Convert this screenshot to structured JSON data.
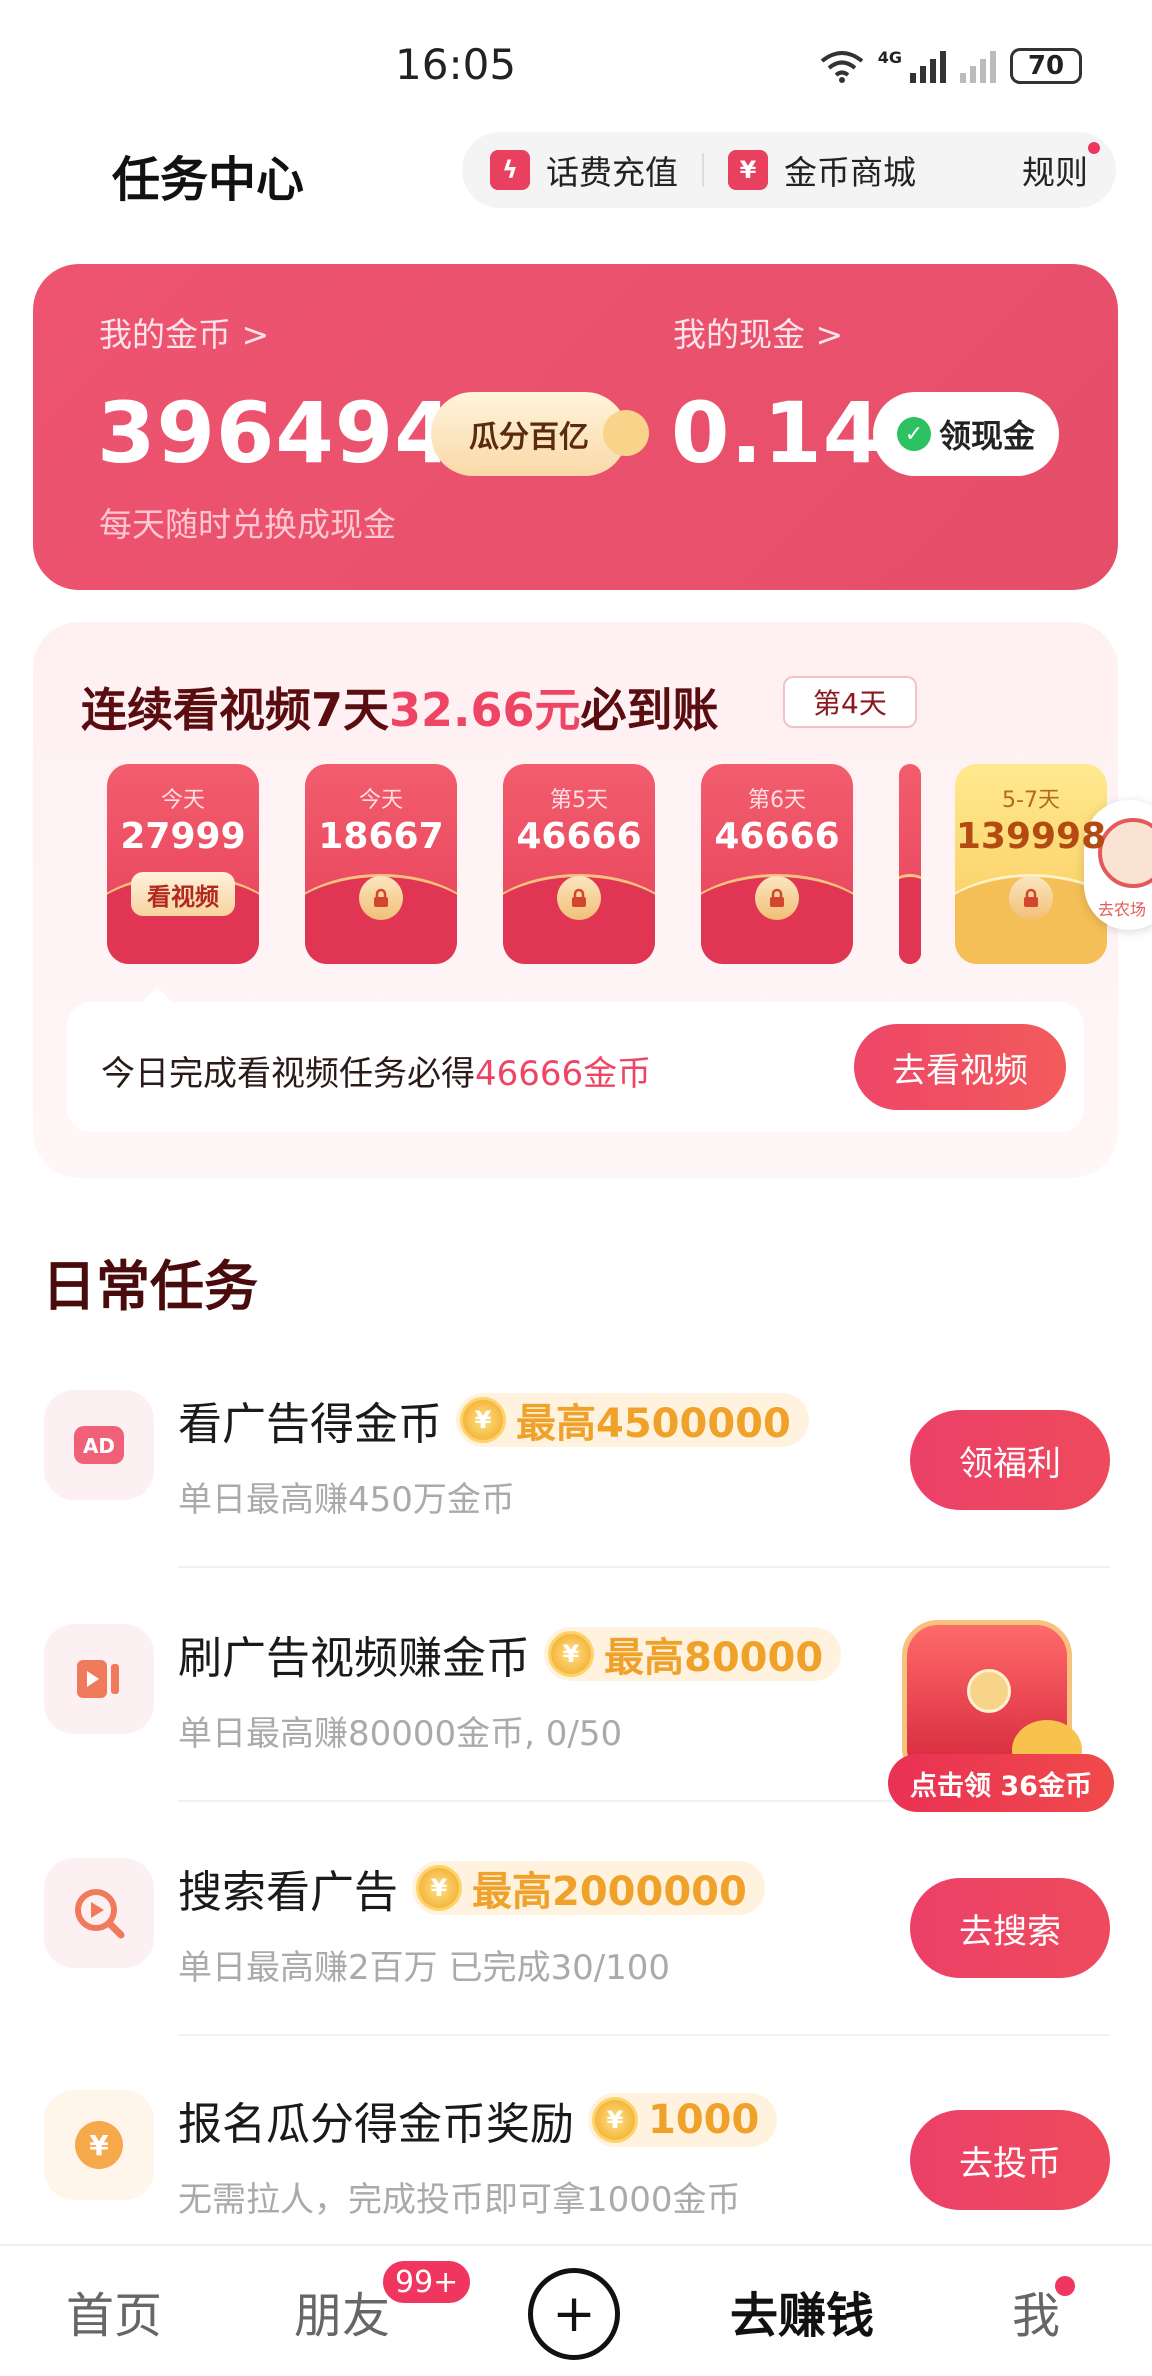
{
  "status": {
    "time": "16:05",
    "network": "4G",
    "battery": "70"
  },
  "header": {
    "title": "任务中心",
    "phone_recharge": "话费充值",
    "coin_mall": "金币商城",
    "rules": "规则"
  },
  "wallet": {
    "coins_label": "我的金币 >",
    "coins_value": "396494",
    "coins_sub": "每天随时兑换成现金",
    "split_button": "瓜分百亿",
    "cash_label": "我的现金 >",
    "cash_value": "0.14",
    "cash_button": "领现金"
  },
  "streak": {
    "title_prefix": "连续看视频7天",
    "title_amount": "32.66元",
    "title_suffix": "必到账",
    "day_tag": "第4天",
    "packets": [
      {
        "day": "今天",
        "value": "27999",
        "action": "看视频"
      },
      {
        "day": "今天",
        "value": "18667"
      },
      {
        "day": "第5天",
        "value": "46666"
      },
      {
        "day": "第6天",
        "value": "46666"
      },
      {
        "day": "5-7天",
        "value": "139998"
      }
    ],
    "notice_prefix": "今日完成看视频任务必得",
    "notice_amount": "46666金币",
    "notice_button": "去看视频"
  },
  "side_float": {
    "label": "去农场"
  },
  "daily": {
    "title": "日常任务",
    "tasks": [
      {
        "name": "看广告得金币",
        "badge": "最高4500000",
        "desc": "单日最高赚450万金币",
        "button": "领福利",
        "icon": "ad-icon"
      },
      {
        "name": "刷广告视频赚金币",
        "badge": "最高80000",
        "desc": "单日最高赚80000金币, 0/50",
        "button": "",
        "icon": "video-icon"
      },
      {
        "name": "搜索看广告",
        "badge": "最高2000000",
        "desc": "单日最高赚2百万 已完成30/100",
        "button": "去搜索",
        "icon": "search-play-icon"
      },
      {
        "name": "报名瓜分得金币奖励",
        "badge": "1000",
        "desc": "无需拉人，完成投币即可拿1000金币",
        "button": "去投币",
        "icon": "yuan-coin-icon"
      }
    ],
    "chest_label": "点击领 36金币"
  },
  "nav": {
    "home": "首页",
    "friends": "朋友",
    "friends_badge": "99+",
    "plus": "+",
    "earn": "去赚钱",
    "me": "我"
  },
  "colors": {
    "accent": "#ee4565",
    "card": "#e9506b",
    "gold": "#f0a12a"
  }
}
